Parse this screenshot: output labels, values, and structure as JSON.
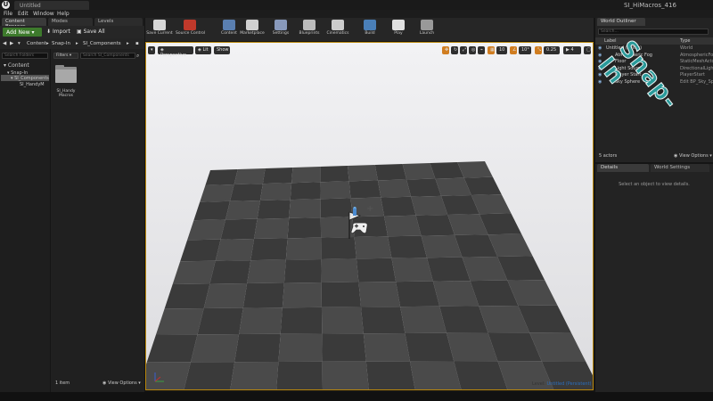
{
  "window": {
    "doc_tab": "Untitled",
    "project_title": "SI_HiMacros_416"
  },
  "menu": [
    "File",
    "Edit",
    "Window",
    "Help"
  ],
  "panel_tabs": {
    "content_browser": "Content Browser",
    "modes": "Modes",
    "levels": "Levels"
  },
  "content_browser": {
    "add_new": "Add New ▾",
    "import": "Import",
    "save_all": "Save All",
    "path": [
      "Content",
      "Snap-In",
      "SI_Components"
    ],
    "search_folders_placeholder": "Search Folders",
    "filters": "Filters ▾",
    "search_placeholder": "Search SI_Components",
    "tree": [
      "Content",
      "Snap-In",
      "SI_Components",
      "SI_HandyM"
    ],
    "asset": {
      "name_line1": "SI_Handy",
      "name_line2": "Macros"
    },
    "item_count": "1 item",
    "view_options": "View Options ▾"
  },
  "toolbar": {
    "items": [
      {
        "label": "Save Current",
        "color": "#d6d6d6"
      },
      {
        "label": "Source Control",
        "color": "#c0392b"
      },
      {
        "label": "Content",
        "color": "#5a7fb0"
      },
      {
        "label": "Marketplace",
        "color": "#d0d0d0"
      },
      {
        "label": "Settings",
        "color": "#8899bb"
      },
      {
        "label": "Blueprints",
        "color": "#bbbbbb"
      },
      {
        "label": "Cinematics",
        "color": "#cccccc"
      },
      {
        "label": "Build",
        "color": "#4a7fb8"
      },
      {
        "label": "Play",
        "color": "#e0e0e0"
      },
      {
        "label": "Launch",
        "color": "#999999"
      }
    ]
  },
  "viewport": {
    "perspective": "Perspective",
    "lit": "Lit",
    "show": "Show",
    "snap_grid": "10",
    "snap_angle": "10°",
    "snap_scale": "0.25",
    "camera_speed": "4",
    "level_label": "Level:",
    "level_name": "Untitled (Persistent)"
  },
  "world_outliner": {
    "tab": "World Outliner",
    "search_placeholder": "Search...",
    "col_label": "Label",
    "col_type": "Type",
    "rows": [
      {
        "label": "Untitled (Editor)",
        "type": "World"
      },
      {
        "label": "Atmospheric Fog",
        "type": "AtmosphericFog"
      },
      {
        "label": "Floor",
        "type": "StaticMeshActor"
      },
      {
        "label": "Light Source",
        "type": "DirectionalLight"
      },
      {
        "label": "Player Start",
        "type": "PlayerStart"
      },
      {
        "label": "Sky Sphere",
        "type": "Edit BP_Sky_Sphere"
      }
    ],
    "actor_count": "5 actors",
    "view_options": "View Options ▾"
  },
  "details": {
    "tab": "Details",
    "world_settings_tab": "World Settings",
    "empty_message": "Select an object to view details."
  },
  "watermark": "Snap-In"
}
